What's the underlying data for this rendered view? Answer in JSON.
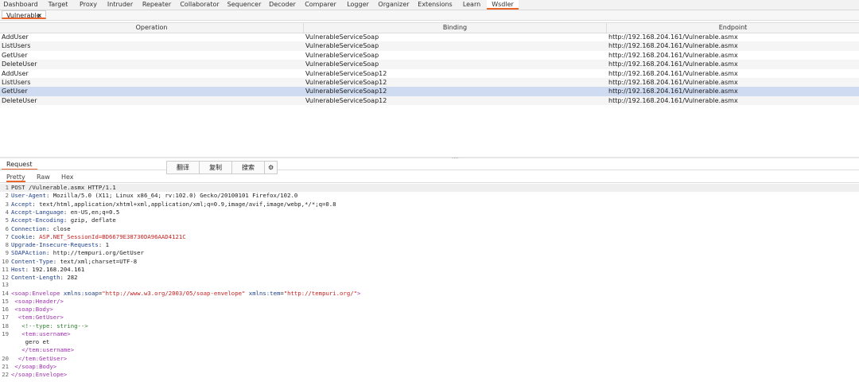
{
  "top_tabs": [
    "Dashboard",
    "Target",
    "Proxy",
    "Intruder",
    "Repeater",
    "Collaborator",
    "Sequencer",
    "Decoder",
    "Comparer",
    "Logger",
    "Organizer",
    "Extensions",
    "Learn",
    "Wsdler"
  ],
  "active_top_tab": "Wsdler",
  "sub_tab": {
    "label": "Vulnerable",
    "close": "×"
  },
  "table": {
    "headers": [
      "Operation",
      "Binding",
      "Endpoint"
    ],
    "rows": [
      {
        "operation": "AddUser",
        "binding": "VulnerableServiceSoap",
        "endpoint": "http://192.168.204.161/Vulnerable.asmx"
      },
      {
        "operation": "ListUsers",
        "binding": "VulnerableServiceSoap",
        "endpoint": "http://192.168.204.161/Vulnerable.asmx"
      },
      {
        "operation": "GetUser",
        "binding": "VulnerableServiceSoap",
        "endpoint": "http://192.168.204.161/Vulnerable.asmx"
      },
      {
        "operation": "DeleteUser",
        "binding": "VulnerableServiceSoap",
        "endpoint": "http://192.168.204.161/Vulnerable.asmx"
      },
      {
        "operation": "AddUser",
        "binding": "VulnerableServiceSoap12",
        "endpoint": "http://192.168.204.161/Vulnerable.asmx"
      },
      {
        "operation": "ListUsers",
        "binding": "VulnerableServiceSoap12",
        "endpoint": "http://192.168.204.161/Vulnerable.asmx"
      },
      {
        "operation": "GetUser",
        "binding": "VulnerableServiceSoap12",
        "endpoint": "http://192.168.204.161/Vulnerable.asmx"
      },
      {
        "operation": "DeleteUser",
        "binding": "VulnerableServiceSoap12",
        "endpoint": "http://192.168.204.161/Vulnerable.asmx"
      }
    ],
    "selected_row": 6
  },
  "splitter_grip": "....",
  "request_tab": "Request",
  "toolbar": {
    "translate": "翻译",
    "copy": "复制",
    "search": "搜索",
    "settings_icon": "gear-icon",
    "settings_glyph": "⚙"
  },
  "view_tabs": [
    "Pretty",
    "Raw",
    "Hex"
  ],
  "active_view_tab": "Pretty",
  "request": {
    "line1": "POST /Vulnerable.asmx HTTP/1.1",
    "headers": [
      {
        "n": "2",
        "name": "User-Agent",
        "value": "Mozilla/5.0 (X11; Linux x86_64; rv:102.0) Gecko/20100101 Firefox/102.0"
      },
      {
        "n": "3",
        "name": "Accept",
        "value": "text/html,application/xhtml+xml,application/xml;q=0.9,image/avif,image/webp,*/*;q=0.8"
      },
      {
        "n": "4",
        "name": "Accept-Language",
        "value": "en-US,en;q=0.5"
      },
      {
        "n": "5",
        "name": "Accept-Encoding",
        "value": "gzip, deflate"
      },
      {
        "n": "6",
        "name": "Connection",
        "value": "close"
      },
      {
        "n": "7",
        "name": "Cookie",
        "value": "ASP.NET_SessionId=BD6679E38730DA96AAD4121C"
      },
      {
        "n": "8",
        "name": "Upgrade-Insecure-Requests",
        "value": "1"
      },
      {
        "n": "9",
        "name": "SOAPAction",
        "value": "http://tempuri.org/GetUser"
      },
      {
        "n": "10",
        "name": "Content-Type",
        "value": "text/xml;charset=UTF-8"
      },
      {
        "n": "11",
        "name": "Host",
        "value": "192.168.204.161"
      },
      {
        "n": "12",
        "name": "Content-Length",
        "value": "282"
      }
    ],
    "body": {
      "l14_tag": "<soap:Envelope",
      "l14_attr1": "xmlns:soap",
      "l14_val1": "\"http://www.w3.org/2003/05/soap-envelope\"",
      "l14_attr2": "xmlns:tem",
      "l14_val2": "\"http://tempuri.org/\"",
      "l14_end": ">",
      "l15": "<soap:Header/>",
      "l16": "<soap:Body>",
      "l17": "<tem:GetUser>",
      "l18": "<!--type: string-->",
      "l19": "<tem:username>",
      "l19_value": "gero et",
      "l19_close": "</tem:username>",
      "l20": "</tem:GetUser>",
      "l21": "</soap:Body>",
      "l22": "</soap:Envelope>"
    }
  }
}
